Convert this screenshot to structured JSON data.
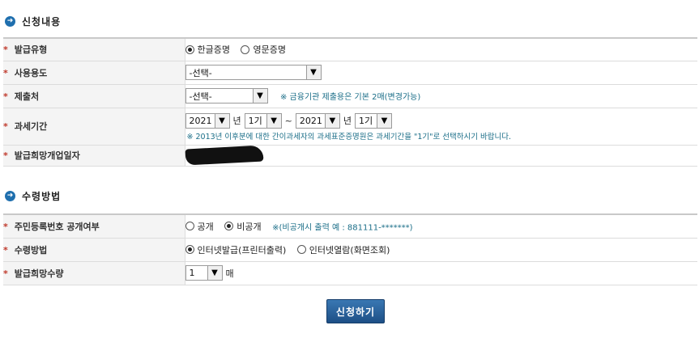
{
  "section1": {
    "title": "신청내용",
    "rows": {
      "issue_type": {
        "label": "발급유형",
        "opt1": "한글증명",
        "opt2": "영문증명"
      },
      "usage": {
        "label": "사용용도",
        "select": "-선택-"
      },
      "submit_to": {
        "label": "제출처",
        "select": "-선택-",
        "note": "※ 금융기관 제출용은 기본 2매(변경가능)"
      },
      "tax_period": {
        "label": "과세기간",
        "year_from": "2021",
        "unit_year": "년",
        "term_from": "1기",
        "tilde": "~",
        "year_to": "2021",
        "unit_year2": "년",
        "term_to": "1기",
        "note": "※ 2013년 이후분에 대한 간이과세자의 과세표준증명원은 과세기간을 \"1기\"로 선택하시기 바랍니다."
      },
      "start_date": {
        "label": "발급희망개업일자"
      }
    }
  },
  "section2": {
    "title": "수령방법",
    "rows": {
      "rrn_disclosure": {
        "label": "주민등록번호 공개여부",
        "opt1": "공개",
        "opt2": "비공개",
        "note": "※(비공개시 출력 예 : 881111-*******)"
      },
      "receive_method": {
        "label": "수령방법",
        "opt1": "인터넷발급(프린터출력)",
        "opt2": "인터넷열람(화면조회)"
      },
      "copies": {
        "label": "발급희망수량",
        "select": "1",
        "unit": "매"
      }
    }
  },
  "submit_label": "신청하기"
}
